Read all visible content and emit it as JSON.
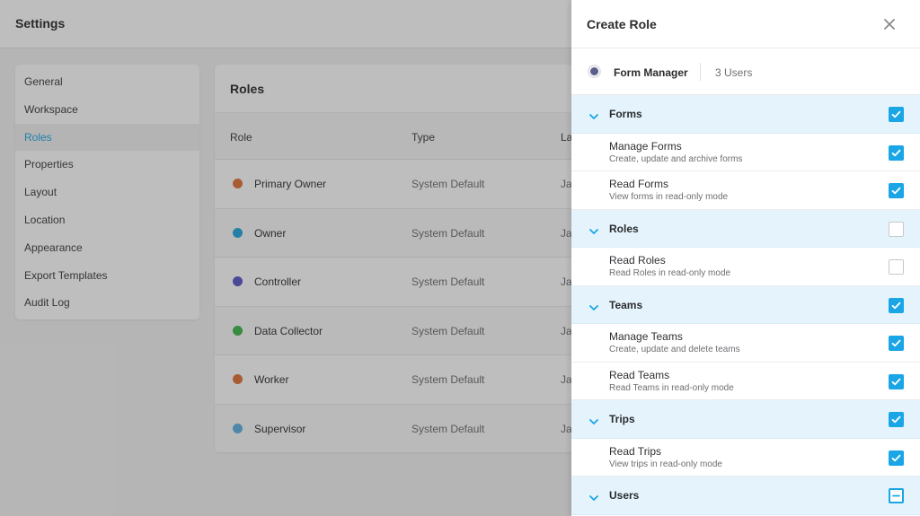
{
  "header": {
    "title": "Settings"
  },
  "sidebar": {
    "items": [
      {
        "label": "General"
      },
      {
        "label": "Workspace"
      },
      {
        "label": "Roles",
        "active": true
      },
      {
        "label": "Properties"
      },
      {
        "label": "Layout"
      },
      {
        "label": "Location"
      },
      {
        "label": "Appearance"
      },
      {
        "label": "Export Templates"
      },
      {
        "label": "Audit Log"
      }
    ]
  },
  "roles_card": {
    "title": "Roles",
    "columns": [
      "Role",
      "Type",
      "La"
    ],
    "rows": [
      {
        "name": "Primary Owner",
        "type": "System Default",
        "last": "Ja",
        "color": "#e0733a"
      },
      {
        "name": "Owner",
        "type": "System Default",
        "last": "Ja",
        "color": "#24a7df"
      },
      {
        "name": "Controller",
        "type": "System Default",
        "last": "Ja",
        "color": "#5b57c9"
      },
      {
        "name": "Data Collector",
        "type": "System Default",
        "last": "Ja",
        "color": "#3fb84b"
      },
      {
        "name": "Worker",
        "type": "System Default",
        "last": "Ja",
        "color": "#e0733a"
      },
      {
        "name": "Supervisor",
        "type": "System Default",
        "last": "Ja",
        "color": "#5fb2e0"
      }
    ]
  },
  "drawer": {
    "title": "Create Role",
    "close_icon": "close-icon",
    "role": {
      "name": "Form Manager",
      "users": "3 Users"
    },
    "groups": [
      {
        "label": "Forms",
        "state": "checked",
        "items": [
          {
            "label": "Manage Forms",
            "desc": "Create, update and archive forms",
            "state": "checked"
          },
          {
            "label": "Read Forms",
            "desc": "View forms in read-only mode",
            "state": "checked"
          }
        ]
      },
      {
        "label": "Roles",
        "state": "unchecked",
        "items": [
          {
            "label": "Read Roles",
            "desc": "Read Roles in read-only mode",
            "state": "unchecked"
          }
        ]
      },
      {
        "label": "Teams",
        "state": "checked",
        "items": [
          {
            "label": "Manage Teams",
            "desc": "Create, update and delete teams",
            "state": "checked"
          },
          {
            "label": "Read Teams",
            "desc": "Read Teams in read-only mode",
            "state": "checked"
          }
        ]
      },
      {
        "label": "Trips",
        "state": "checked",
        "items": [
          {
            "label": "Read Trips",
            "desc": "View trips in read-only mode",
            "state": "checked"
          }
        ]
      },
      {
        "label": "Users",
        "state": "partial",
        "items": []
      }
    ]
  },
  "colors": {
    "accent": "#1aa6e6",
    "group_bg": "#e5f4fc"
  }
}
